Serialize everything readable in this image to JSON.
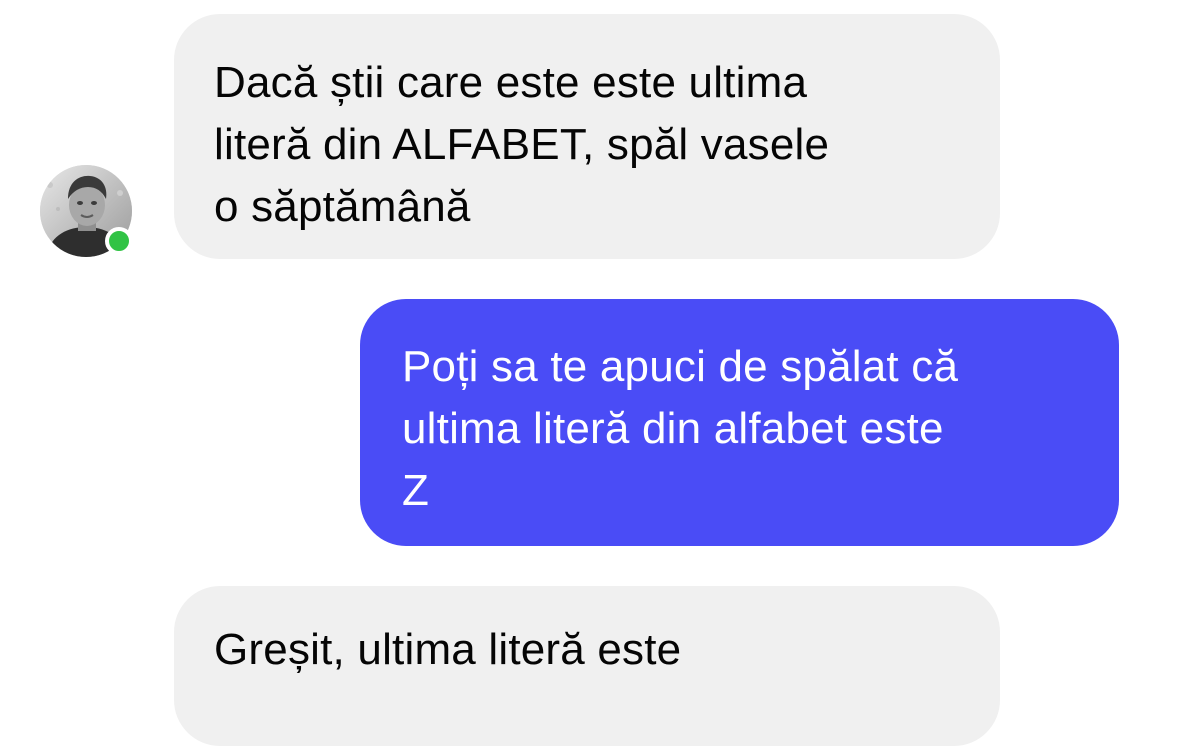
{
  "conversation": {
    "messages": [
      {
        "sender": "contact",
        "text": "Dacă știi care este este ultima\nliteră din ALFABET, spăl vasele\no săptămână"
      },
      {
        "sender": "me",
        "text": "Poți sa te apuci de spălat că\nultima literă din alfabet este\nZ"
      },
      {
        "sender": "contact",
        "text": "Greșit, ultima literă este"
      }
    ],
    "contact": {
      "avatar_icon": "person-photo-icon",
      "status": "online",
      "status_color": "#31c345"
    }
  },
  "colors": {
    "incoming_bubble": "#f0f0f0",
    "outgoing_bubble": "#4a4cf6",
    "incoming_text": "#050505",
    "outgoing_text": "#ffffff"
  }
}
